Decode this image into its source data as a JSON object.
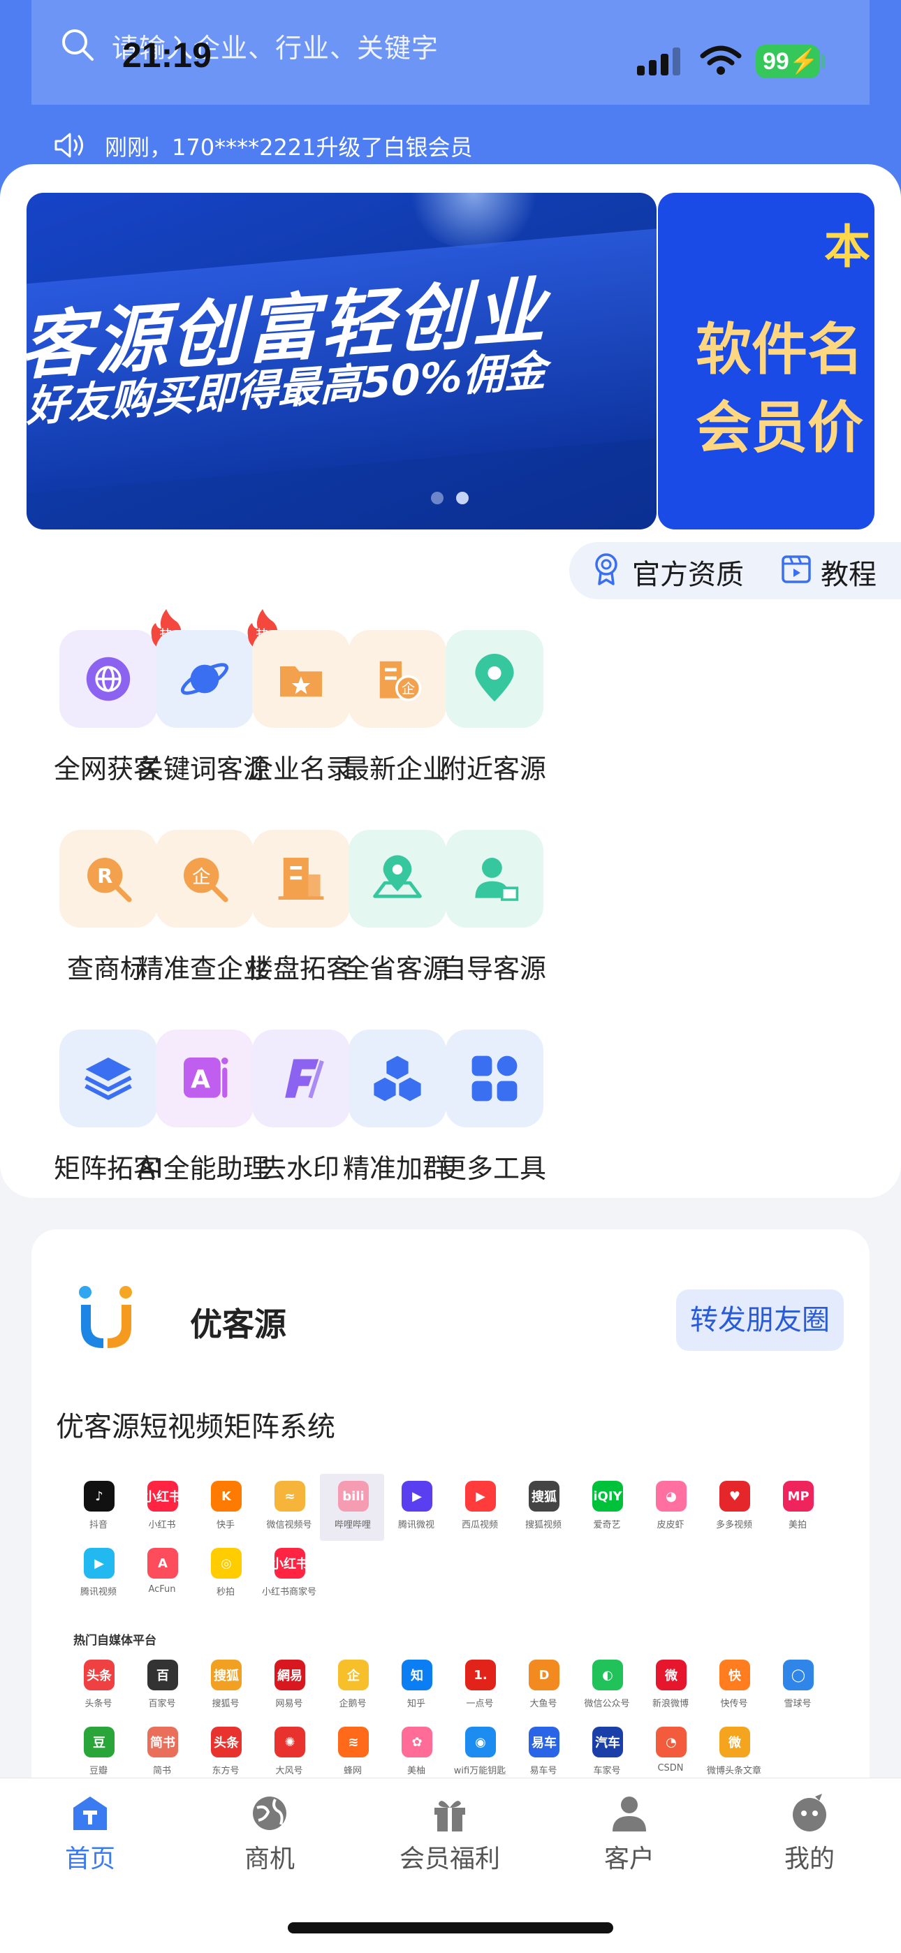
{
  "status_bar": {
    "time": "21:19",
    "battery": "99"
  },
  "search": {
    "placeholder": "请输入企业、行业、关键字"
  },
  "notice": {
    "text": "刚刚，170****2221升级了白银会员"
  },
  "banner": {
    "title": "客源创富轻创业",
    "subtitle": "好友购买即得最高50%佣金",
    "side_corner": "本",
    "side_line1": "软件名",
    "side_line2": "会员价",
    "dots": 2,
    "active_dot": 1
  },
  "quick_links": {
    "certification": "官方资质",
    "tutorial": "教程"
  },
  "hot_badge": "热",
  "tools": [
    {
      "label": "全网获客",
      "icon": "globe-network-icon",
      "hot": true,
      "color": "#8c63f0",
      "bg": "#f1ecfd"
    },
    {
      "label": "关键词客源",
      "icon": "planet-icon",
      "hot": true,
      "color": "#3a6ff2",
      "bg": "#e7effd"
    },
    {
      "label": "企业名录",
      "icon": "folder-star-icon",
      "hot": false,
      "color": "#f3a14c",
      "bg": "#fdf1e4"
    },
    {
      "label": "最新企业",
      "icon": "building-new-icon",
      "hot": false,
      "color": "#f3a14c",
      "bg": "#fdf1e4"
    },
    {
      "label": "附近客源",
      "icon": "location-pin-icon",
      "hot": false,
      "color": "#37c79e",
      "bg": "#e4f7f1"
    },
    {
      "label": "查商标",
      "icon": "trademark-search-icon",
      "hot": false,
      "color": "#f3a14c",
      "bg": "#fdf1e4"
    },
    {
      "label": "精准查企业",
      "icon": "company-search-icon",
      "hot": false,
      "color": "#f3a14c",
      "bg": "#fdf1e4"
    },
    {
      "label": "楼盘拓客",
      "icon": "building-icon",
      "hot": false,
      "color": "#f3a14c",
      "bg": "#fdf1e4"
    },
    {
      "label": "全省客源",
      "icon": "map-pin-icon",
      "hot": false,
      "color": "#37c79e",
      "bg": "#e4f7f1"
    },
    {
      "label": "自导客源",
      "icon": "user-guide-icon",
      "hot": false,
      "color": "#37c79e",
      "bg": "#e4f7f1"
    },
    {
      "label": "矩阵拓客",
      "icon": "layers-icon",
      "hot": false,
      "color": "#3a6ff2",
      "bg": "#e7effd"
    },
    {
      "label": "AI全能助理",
      "icon": "ai-assistant-icon",
      "hot": false,
      "color": "#c05ef0",
      "bg": "#f6eafd"
    },
    {
      "label": "去水印",
      "icon": "watermark-remove-icon",
      "hot": false,
      "color": "#8c63f0",
      "bg": "#f1ecfd"
    },
    {
      "label": "精准加群",
      "icon": "cubes-icon",
      "hot": false,
      "color": "#3a6ff2",
      "bg": "#e7effd"
    },
    {
      "label": "更多工具",
      "icon": "grid-more-icon",
      "hot": false,
      "color": "#3a6ff2",
      "bg": "#e7effd"
    }
  ],
  "promo": {
    "title": "优客源",
    "share_button": "转发朋友圈",
    "subtitle": "优客源短视频矩阵系统",
    "hot_platforms_label": "热门自媒体平台"
  },
  "video_platforms": [
    {
      "label": "抖音",
      "glyph": "♪",
      "color": "#111111"
    },
    {
      "label": "小红书",
      "glyph": "小红书",
      "color": "#ff2442"
    },
    {
      "label": "快手",
      "glyph": "K",
      "color": "#ff7a00"
    },
    {
      "label": "微信视频号",
      "glyph": "≈",
      "color": "#f6b53a"
    },
    {
      "label": "哔哩哔哩",
      "glyph": "bili",
      "color": "#f59cb3"
    },
    {
      "label": "腾讯微视",
      "glyph": "▶",
      "color": "#5a3ff0"
    },
    {
      "label": "西瓜视频",
      "glyph": "▶",
      "color": "#ff3b3b"
    },
    {
      "label": "搜狐视频",
      "glyph": "搜狐",
      "color": "#444444"
    },
    {
      "label": "爱奇艺",
      "glyph": "iQIY",
      "color": "#00c13a"
    },
    {
      "label": "皮皮虾",
      "glyph": "◕",
      "color": "#ff6fa0"
    },
    {
      "label": "多多视频",
      "glyph": "♥",
      "color": "#e5262b"
    },
    {
      "label": "美拍",
      "glyph": "MP",
      "color": "#f0245c"
    },
    {
      "label": "腾讯视频",
      "glyph": "▶",
      "color": "#22b8f0"
    },
    {
      "label": "AcFun",
      "glyph": "A",
      "color": "#fd4c5b"
    },
    {
      "label": "秒拍",
      "glyph": "◎",
      "color": "#ffcc00"
    },
    {
      "label": "小红书商家号",
      "glyph": "小红书",
      "color": "#ff2442"
    }
  ],
  "media_platforms": [
    {
      "label": "头条号",
      "glyph": "头条",
      "color": "#f04142"
    },
    {
      "label": "百家号",
      "glyph": "百",
      "color": "#333333"
    },
    {
      "label": "搜狐号",
      "glyph": "搜狐",
      "color": "#f2a022"
    },
    {
      "label": "网易号",
      "glyph": "網易",
      "color": "#d9171e"
    },
    {
      "label": "企鹅号",
      "glyph": "企",
      "color": "#f7c02a"
    },
    {
      "label": "知乎",
      "glyph": "知",
      "color": "#0a7ef2"
    },
    {
      "label": "一点号",
      "glyph": "1.",
      "color": "#e2231a"
    },
    {
      "label": "大鱼号",
      "glyph": "D",
      "color": "#f28a20"
    },
    {
      "label": "微信公众号",
      "glyph": "◐",
      "color": "#22c25a"
    },
    {
      "label": "新浪微博",
      "glyph": "微",
      "color": "#e6162d"
    },
    {
      "label": "快传号",
      "glyph": "快",
      "color": "#ff7c1f"
    },
    {
      "label": "雪球号",
      "glyph": "◯",
      "color": "#2f86e8"
    },
    {
      "label": "豆瓣",
      "glyph": "豆",
      "color": "#2aa53a"
    },
    {
      "label": "简书",
      "glyph": "简书",
      "color": "#ea6f5a"
    },
    {
      "label": "东方号",
      "glyph": "头条",
      "color": "#e8322e"
    },
    {
      "label": "大风号",
      "glyph": "✺",
      "color": "#e8322e"
    },
    {
      "label": "蜂网",
      "glyph": "≋",
      "color": "#ff6a1a"
    },
    {
      "label": "美柚",
      "glyph": "✿",
      "color": "#ff6c98"
    },
    {
      "label": "wifi万能钥匙",
      "glyph": "◉",
      "color": "#1d8cf0"
    },
    {
      "label": "易车号",
      "glyph": "易车",
      "color": "#2a65e8"
    },
    {
      "label": "车家号",
      "glyph": "汽车",
      "color": "#1a3fa8"
    },
    {
      "label": "CSDN",
      "glyph": "◔",
      "color": "#f25c3c"
    },
    {
      "label": "微博头条文章",
      "glyph": "微",
      "color": "#f4a41d"
    }
  ],
  "tabbar": [
    {
      "label": "首页",
      "icon": "home-icon",
      "active": true
    },
    {
      "label": "商机",
      "icon": "globe-icon",
      "active": false
    },
    {
      "label": "会员福利",
      "icon": "gift-icon",
      "active": false
    },
    {
      "label": "客户",
      "icon": "user-icon",
      "active": false
    },
    {
      "label": "我的",
      "icon": "profile-icon",
      "active": false
    }
  ]
}
